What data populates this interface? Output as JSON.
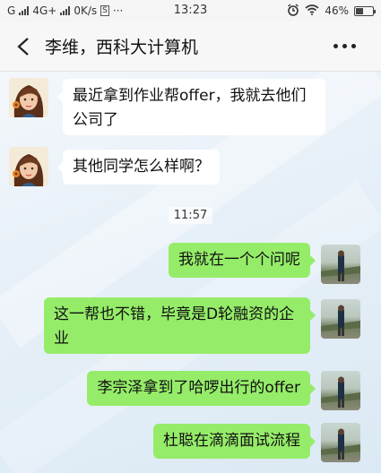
{
  "status_bar": {
    "carrier_left": "G",
    "network": "4G+",
    "speed": "0K/s",
    "sim_badge": "S",
    "extra": "···",
    "time": "13:23",
    "battery": "46%",
    "battery_level": 0.46
  },
  "header": {
    "title": "李维，西科大计算机"
  },
  "messages": [
    {
      "side": "left",
      "text": "最近拿到作业帮offer，我就去他们公司了"
    },
    {
      "side": "left",
      "text": "其他同学怎么样啊？"
    },
    {
      "side": "time",
      "text": "11:57"
    },
    {
      "side": "right",
      "text": "我就在一个个问呢"
    },
    {
      "side": "right",
      "text": "这一帮也不错，毕竟是D轮融资的企业"
    },
    {
      "side": "right",
      "text": "李宗泽拿到了哈啰出行的offer"
    },
    {
      "side": "right",
      "text": "杜聪在滴滴面试流程"
    }
  ],
  "colors": {
    "self_bubble": "#95ec69",
    "other_bubble": "#ffffff"
  },
  "icons": {
    "back": "chevron-left-icon",
    "more": "more-horizontal-icon",
    "alarm": "alarm-icon",
    "wifi": "wifi-icon"
  }
}
